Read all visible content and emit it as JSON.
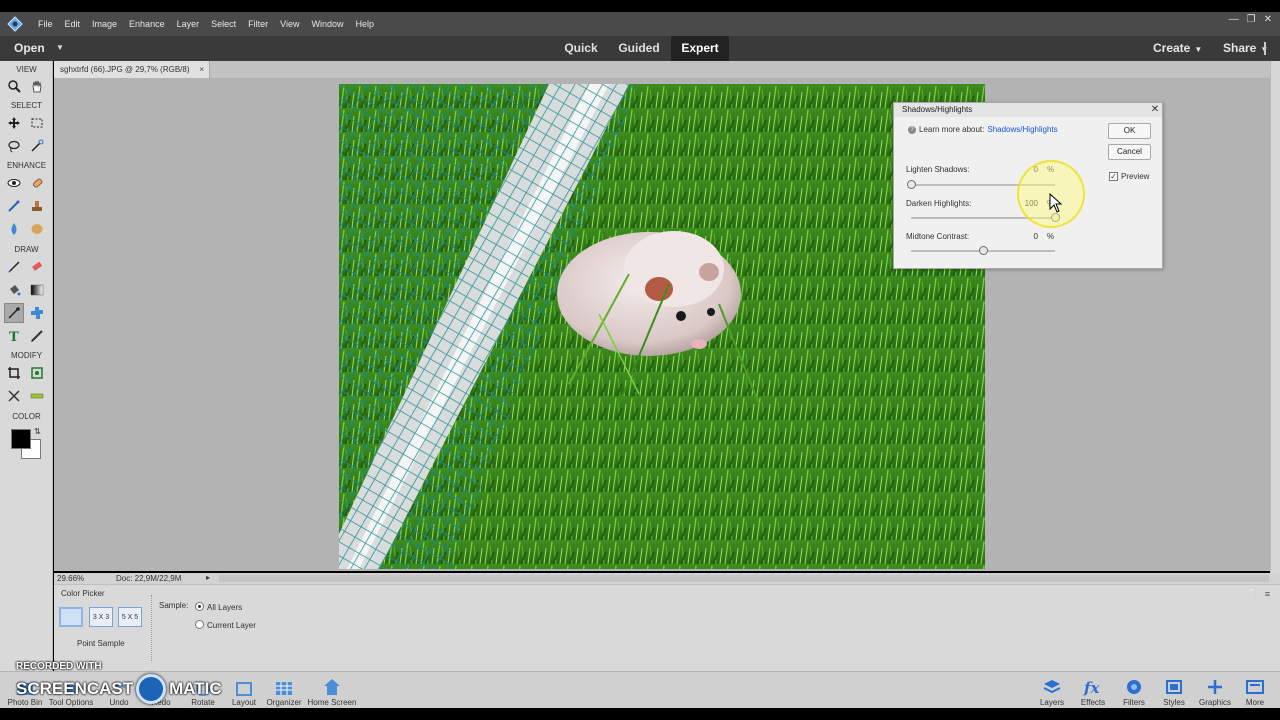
{
  "menubar": {
    "items": [
      "File",
      "Edit",
      "Image",
      "Enhance",
      "Layer",
      "Select",
      "Filter",
      "View",
      "Window",
      "Help"
    ]
  },
  "modebar": {
    "open_label": "Open",
    "tabs": [
      {
        "label": "Quick"
      },
      {
        "label": "Guided"
      },
      {
        "label": "Expert"
      }
    ],
    "active_tab": "Expert",
    "create_label": "Create",
    "share_label": "Share"
  },
  "toolbox": {
    "sections": {
      "view": "VIEW",
      "select": "SELECT",
      "enhance": "ENHANCE",
      "draw": "DRAW",
      "modify": "MODIFY",
      "color": "COLOR"
    },
    "foreground_color": "#000000",
    "background_color": "#ffffff"
  },
  "document": {
    "tab_title": "sghxtrfd (66).JPG @ 29,7% (RGB/8)"
  },
  "statusbar": {
    "zoom": "29.66%",
    "doc": "Doc: 22,9M/22,9M"
  },
  "dialog": {
    "title": "Shadows/Highlights",
    "learn_prefix": "Learn more about:",
    "learn_link": "Shadows/Highlights",
    "ok_label": "OK",
    "cancel_label": "Cancel",
    "preview_label": "Preview",
    "preview_checked": true,
    "sliders": [
      {
        "label": "Lighten Shadows:",
        "value": "0",
        "unit": "%",
        "level": 0
      },
      {
        "label": "Darken Highlights:",
        "value": "100",
        "unit": "%",
        "level": 1
      },
      {
        "label": "Midtone Contrast:",
        "value": "0",
        "unit": "%",
        "level": 0.5
      }
    ]
  },
  "tool_options": {
    "title": "Color Picker",
    "sample_sizes": [
      "3 X 3",
      "5 X 5"
    ],
    "point_sample_label": "Point Sample",
    "sample_label": "Sample:",
    "sample_options": [
      "All Layers",
      "Current Layer"
    ],
    "selected_sample": "All Layers"
  },
  "bottombar": {
    "left_items": [
      "Photo Bin",
      "Tool Options",
      "Undo",
      "Redo",
      "Rotate",
      "Layout",
      "Organizer",
      "Home Screen"
    ],
    "right_items": [
      "Layers",
      "Effects",
      "Filters",
      "Styles",
      "Graphics",
      "More"
    ]
  },
  "watermark": {
    "line1": "RECORDED WITH",
    "line2a": "SCREENCAST",
    "line2b": "MATIC"
  },
  "colors": {
    "accent_link": "#1a55c9",
    "highlight": "#f5ef6a"
  }
}
